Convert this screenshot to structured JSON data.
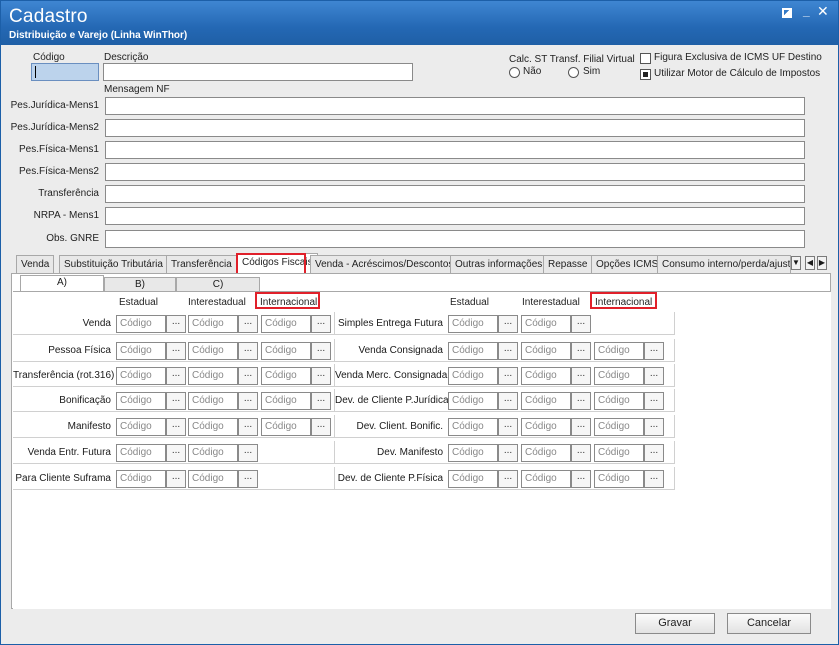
{
  "window": {
    "title": "Cadastro",
    "subtitle": "Distribuição e Varejo (Linha WinThor)"
  },
  "header": {
    "codigo_label": "Código",
    "descricao_label": "Descrição",
    "mensagem_nf_label": "Mensagem NF",
    "calc_st_label": "Calc. ST Transf. Filial Virtual",
    "radio_nao": "Não",
    "radio_sim": "Sim",
    "chk_figura": "Figura Exclusiva de ICMS UF Destino",
    "chk_motor": "Utilizar Motor de Cálculo de Impostos"
  },
  "messages": [
    {
      "label": "Pes.Jurídica-Mens1"
    },
    {
      "label": "Pes.Jurídica-Mens2"
    },
    {
      "label": "Pes.Física-Mens1"
    },
    {
      "label": "Pes.Física-Mens2"
    },
    {
      "label": "Transferência"
    },
    {
      "label": "NRPA - Mens1"
    },
    {
      "label": "Obs. GNRE"
    }
  ],
  "tabs": [
    {
      "label": "Venda"
    },
    {
      "label": "Substituição Tributária"
    },
    {
      "label": "Transferência"
    },
    {
      "label": "Códigos Fiscais"
    },
    {
      "label": "Venda - Acréscimos/Descontos"
    },
    {
      "label": "Outras informações"
    },
    {
      "label": "Repasse"
    },
    {
      "label": "Opções ICMS"
    },
    {
      "label": "Consumo interno/perda/ajuste"
    }
  ],
  "subtabs": [
    {
      "label": "A)"
    },
    {
      "label": "B)"
    },
    {
      "label": "C)"
    }
  ],
  "columns": {
    "estadual": "Estadual",
    "interestadual": "Interestadual",
    "internacional": "Internacional"
  },
  "placeholder": "Código",
  "ellipsis": "...",
  "left_rows": [
    {
      "label": "Venda"
    },
    {
      "label": "Pessoa Física"
    },
    {
      "label": "Transferência (rot.316)"
    },
    {
      "label": "Bonificação"
    },
    {
      "label": "Manifesto"
    },
    {
      "label": "Venda Entr. Futura"
    },
    {
      "label": "Para Cliente Suframa"
    }
  ],
  "right_rows": [
    {
      "label": "Simples Entrega Futura"
    },
    {
      "label": "Venda Consignada"
    },
    {
      "label": "Venda Merc. Consignada"
    },
    {
      "label": "Dev. de Cliente P.Jurídica"
    },
    {
      "label": "Dev. Client. Bonific."
    },
    {
      "label": "Dev. Manifesto"
    },
    {
      "label": "Dev. de Cliente P.Física"
    }
  ],
  "buttons": {
    "gravar": "Gravar",
    "cancelar": "Cancelar"
  },
  "colors": {
    "titlebar": "#2468b4",
    "highlight": "#e0202a"
  }
}
